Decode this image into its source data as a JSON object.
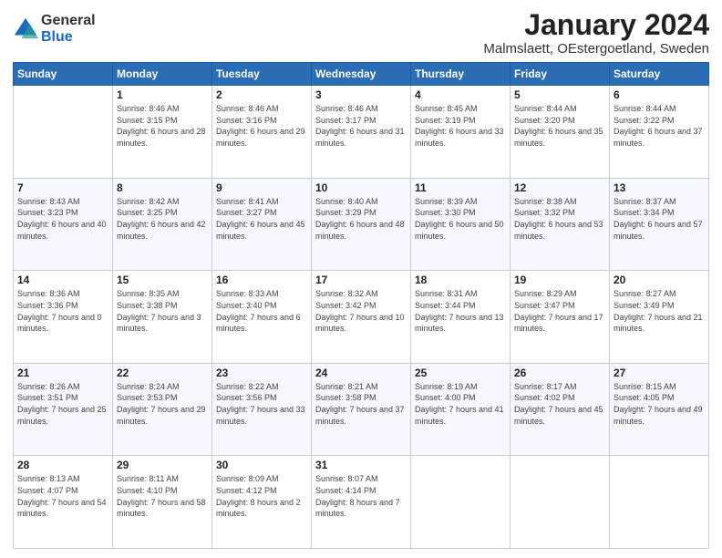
{
  "logo": {
    "general": "General",
    "blue": "Blue"
  },
  "title": "January 2024",
  "subtitle": "Malmslaett, OEstergoetland, Sweden",
  "days": [
    "Sunday",
    "Monday",
    "Tuesday",
    "Wednesday",
    "Thursday",
    "Friday",
    "Saturday"
  ],
  "weeks": [
    [
      {
        "num": "",
        "sunrise": "",
        "sunset": "",
        "daylight": ""
      },
      {
        "num": "1",
        "sunrise": "Sunrise: 8:46 AM",
        "sunset": "Sunset: 3:15 PM",
        "daylight": "Daylight: 6 hours and 28 minutes."
      },
      {
        "num": "2",
        "sunrise": "Sunrise: 8:46 AM",
        "sunset": "Sunset: 3:16 PM",
        "daylight": "Daylight: 6 hours and 29 minutes."
      },
      {
        "num": "3",
        "sunrise": "Sunrise: 8:46 AM",
        "sunset": "Sunset: 3:17 PM",
        "daylight": "Daylight: 6 hours and 31 minutes."
      },
      {
        "num": "4",
        "sunrise": "Sunrise: 8:45 AM",
        "sunset": "Sunset: 3:19 PM",
        "daylight": "Daylight: 6 hours and 33 minutes."
      },
      {
        "num": "5",
        "sunrise": "Sunrise: 8:44 AM",
        "sunset": "Sunset: 3:20 PM",
        "daylight": "Daylight: 6 hours and 35 minutes."
      },
      {
        "num": "6",
        "sunrise": "Sunrise: 8:44 AM",
        "sunset": "Sunset: 3:22 PM",
        "daylight": "Daylight: 6 hours and 37 minutes."
      }
    ],
    [
      {
        "num": "7",
        "sunrise": "Sunrise: 8:43 AM",
        "sunset": "Sunset: 3:23 PM",
        "daylight": "Daylight: 6 hours and 40 minutes."
      },
      {
        "num": "8",
        "sunrise": "Sunrise: 8:42 AM",
        "sunset": "Sunset: 3:25 PM",
        "daylight": "Daylight: 6 hours and 42 minutes."
      },
      {
        "num": "9",
        "sunrise": "Sunrise: 8:41 AM",
        "sunset": "Sunset: 3:27 PM",
        "daylight": "Daylight: 6 hours and 45 minutes."
      },
      {
        "num": "10",
        "sunrise": "Sunrise: 8:40 AM",
        "sunset": "Sunset: 3:29 PM",
        "daylight": "Daylight: 6 hours and 48 minutes."
      },
      {
        "num": "11",
        "sunrise": "Sunrise: 8:39 AM",
        "sunset": "Sunset: 3:30 PM",
        "daylight": "Daylight: 6 hours and 50 minutes."
      },
      {
        "num": "12",
        "sunrise": "Sunrise: 8:38 AM",
        "sunset": "Sunset: 3:32 PM",
        "daylight": "Daylight: 6 hours and 53 minutes."
      },
      {
        "num": "13",
        "sunrise": "Sunrise: 8:37 AM",
        "sunset": "Sunset: 3:34 PM",
        "daylight": "Daylight: 6 hours and 57 minutes."
      }
    ],
    [
      {
        "num": "14",
        "sunrise": "Sunrise: 8:36 AM",
        "sunset": "Sunset: 3:36 PM",
        "daylight": "Daylight: 7 hours and 0 minutes."
      },
      {
        "num": "15",
        "sunrise": "Sunrise: 8:35 AM",
        "sunset": "Sunset: 3:38 PM",
        "daylight": "Daylight: 7 hours and 3 minutes."
      },
      {
        "num": "16",
        "sunrise": "Sunrise: 8:33 AM",
        "sunset": "Sunset: 3:40 PM",
        "daylight": "Daylight: 7 hours and 6 minutes."
      },
      {
        "num": "17",
        "sunrise": "Sunrise: 8:32 AM",
        "sunset": "Sunset: 3:42 PM",
        "daylight": "Daylight: 7 hours and 10 minutes."
      },
      {
        "num": "18",
        "sunrise": "Sunrise: 8:31 AM",
        "sunset": "Sunset: 3:44 PM",
        "daylight": "Daylight: 7 hours and 13 minutes."
      },
      {
        "num": "19",
        "sunrise": "Sunrise: 8:29 AM",
        "sunset": "Sunset: 3:47 PM",
        "daylight": "Daylight: 7 hours and 17 minutes."
      },
      {
        "num": "20",
        "sunrise": "Sunrise: 8:27 AM",
        "sunset": "Sunset: 3:49 PM",
        "daylight": "Daylight: 7 hours and 21 minutes."
      }
    ],
    [
      {
        "num": "21",
        "sunrise": "Sunrise: 8:26 AM",
        "sunset": "Sunset: 3:51 PM",
        "daylight": "Daylight: 7 hours and 25 minutes."
      },
      {
        "num": "22",
        "sunrise": "Sunrise: 8:24 AM",
        "sunset": "Sunset: 3:53 PM",
        "daylight": "Daylight: 7 hours and 29 minutes."
      },
      {
        "num": "23",
        "sunrise": "Sunrise: 8:22 AM",
        "sunset": "Sunset: 3:56 PM",
        "daylight": "Daylight: 7 hours and 33 minutes."
      },
      {
        "num": "24",
        "sunrise": "Sunrise: 8:21 AM",
        "sunset": "Sunset: 3:58 PM",
        "daylight": "Daylight: 7 hours and 37 minutes."
      },
      {
        "num": "25",
        "sunrise": "Sunrise: 8:19 AM",
        "sunset": "Sunset: 4:00 PM",
        "daylight": "Daylight: 7 hours and 41 minutes."
      },
      {
        "num": "26",
        "sunrise": "Sunrise: 8:17 AM",
        "sunset": "Sunset: 4:02 PM",
        "daylight": "Daylight: 7 hours and 45 minutes."
      },
      {
        "num": "27",
        "sunrise": "Sunrise: 8:15 AM",
        "sunset": "Sunset: 4:05 PM",
        "daylight": "Daylight: 7 hours and 49 minutes."
      }
    ],
    [
      {
        "num": "28",
        "sunrise": "Sunrise: 8:13 AM",
        "sunset": "Sunset: 4:07 PM",
        "daylight": "Daylight: 7 hours and 54 minutes."
      },
      {
        "num": "29",
        "sunrise": "Sunrise: 8:11 AM",
        "sunset": "Sunset: 4:10 PM",
        "daylight": "Daylight: 7 hours and 58 minutes."
      },
      {
        "num": "30",
        "sunrise": "Sunrise: 8:09 AM",
        "sunset": "Sunset: 4:12 PM",
        "daylight": "Daylight: 8 hours and 2 minutes."
      },
      {
        "num": "31",
        "sunrise": "Sunrise: 8:07 AM",
        "sunset": "Sunset: 4:14 PM",
        "daylight": "Daylight: 8 hours and 7 minutes."
      },
      {
        "num": "",
        "sunrise": "",
        "sunset": "",
        "daylight": ""
      },
      {
        "num": "",
        "sunrise": "",
        "sunset": "",
        "daylight": ""
      },
      {
        "num": "",
        "sunrise": "",
        "sunset": "",
        "daylight": ""
      }
    ]
  ]
}
